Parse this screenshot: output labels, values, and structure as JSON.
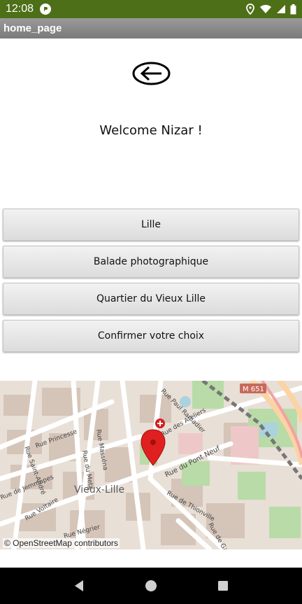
{
  "status_bar": {
    "time": "12:08",
    "icons": [
      "app-notification-icon",
      "location-icon",
      "wifi-icon",
      "signal-icon",
      "battery-icon"
    ],
    "color": "#4d6f18"
  },
  "title_bar": {
    "title": "home_page"
  },
  "main": {
    "back_icon": "back-arrow-icon",
    "welcome": "Welcome Nizar !",
    "buttons": [
      {
        "label": "Lille"
      },
      {
        "label": "Balade photographique"
      },
      {
        "label": "Quartier du Vieux Lille"
      },
      {
        "label": "Confirmer votre choix"
      }
    ]
  },
  "map": {
    "district_label": "Vieux-Lille",
    "street_labels": [
      "Rue Princesse",
      "Rue Saint-André",
      "Rue de Jemmapes",
      "Rue Voltaire",
      "Rue du Pont Neuf",
      "Rue de Thionville",
      "Rue Négrier",
      "Rue Masséna",
      "Rue de Gand",
      "Rue Paul Ramadier",
      "Rue des Ateliers",
      "Rue du Metz"
    ],
    "road_badge": "M 651",
    "attribution": "© OpenStreetMap contributors",
    "marker_icon": "map-pin-icon",
    "marker_color": "#e02020"
  },
  "nav_bar": {
    "icons": [
      "back-triangle-icon",
      "home-circle-icon",
      "recents-square-icon"
    ]
  }
}
